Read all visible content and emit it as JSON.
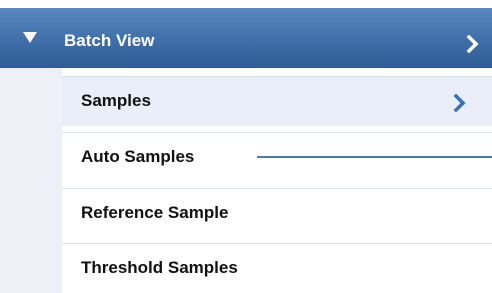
{
  "header": {
    "title": "Batch View",
    "icons": {
      "collapse": "triangle-down-icon",
      "expand": "chevron-right-icon"
    }
  },
  "items": [
    {
      "label": "Samples",
      "selected": true,
      "icon": "chevron-right-icon"
    },
    {
      "label": "Auto Samples",
      "selected": false
    },
    {
      "label": "Reference Sample",
      "selected": false
    },
    {
      "label": "Threshold Samples",
      "selected": false
    }
  ],
  "colors": {
    "header_blue": "#3f6ea8",
    "selected_bg": "#e9eef8",
    "chevron_blue": "#3a72b8",
    "callout_line": "#4a7bb6"
  }
}
